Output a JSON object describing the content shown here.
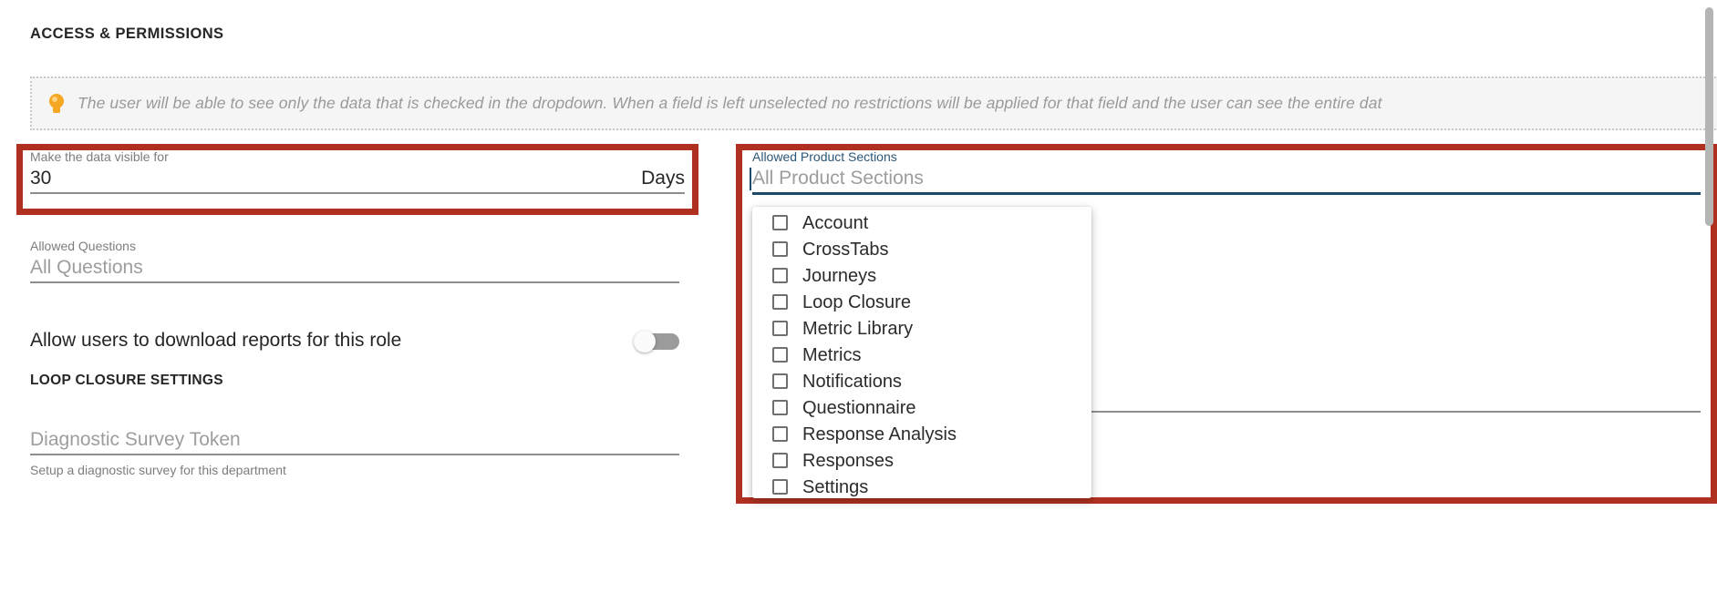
{
  "section": {
    "heading": "ACCESS & PERMISSIONS"
  },
  "info_banner": {
    "icon": "lightbulb-icon",
    "text": "The user will be able to see only the data that is checked in the dropdown. When a field is left unselected no restrictions will be applied for that field and the user can see the entire dat"
  },
  "left_column": {
    "visible_days": {
      "label": "Make the data visible for",
      "value": "30",
      "suffix": "Days"
    },
    "allowed_questions": {
      "label": "Allowed Questions",
      "placeholder": "All Questions",
      "value": ""
    },
    "download_toggle": {
      "label": "Allow users to download reports for this role",
      "state": "off"
    },
    "loop_closure_heading": "LOOP CLOSURE SETTINGS",
    "diagnostic_token": {
      "placeholder": "Diagnostic Survey Token",
      "value": "",
      "helper": "Setup a diagnostic survey for this department"
    }
  },
  "right_column": {
    "allowed_product_sections": {
      "label": "Allowed Product Sections",
      "placeholder": "All Product Sections",
      "value": "",
      "focused": true
    },
    "dropdown": {
      "options": [
        {
          "label": "Account",
          "checked": false
        },
        {
          "label": "CrossTabs",
          "checked": false
        },
        {
          "label": "Journeys",
          "checked": false
        },
        {
          "label": "Loop Closure",
          "checked": false
        },
        {
          "label": "Metric Library",
          "checked": false
        },
        {
          "label": "Metrics",
          "checked": false
        },
        {
          "label": "Notifications",
          "checked": false
        },
        {
          "label": "Questionnaire",
          "checked": false
        },
        {
          "label": "Response Analysis",
          "checked": false
        },
        {
          "label": "Responses",
          "checked": false
        },
        {
          "label": "Settings",
          "checked": false
        }
      ],
      "scrollbar_visible": true
    }
  },
  "annotations": {
    "highlight_color": "#b03020",
    "boxes": [
      {
        "name": "make-data-visible-highlight"
      },
      {
        "name": "allowed-product-sections-highlight"
      }
    ]
  },
  "colors": {
    "accent_blue": "#1d4a68",
    "label_blue": "#2c5777",
    "highlight_red": "#b03020",
    "bulb_yellow": "#f5a623",
    "muted_text": "#7d7d7d",
    "placeholder_text": "#9d9d9d",
    "underline_grey": "#8e8e8e"
  }
}
